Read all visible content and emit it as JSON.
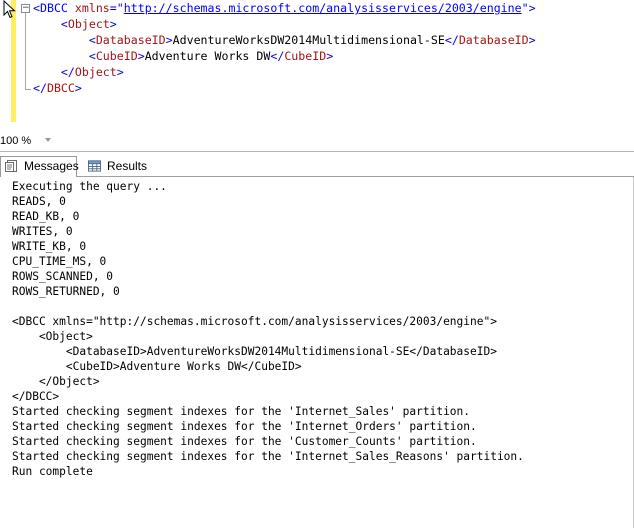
{
  "editor": {
    "lines": [
      {
        "indent": "",
        "parts": [
          {
            "text": "<DBCC ",
            "color": "blue"
          },
          {
            "text": "xmlns",
            "color": "red"
          },
          {
            "text": "=\"",
            "color": "blue"
          },
          {
            "text": "http://schemas.microsoft.com/analysisservices/2003/engine",
            "color": "link"
          },
          {
            "text": "\">",
            "color": "blue"
          }
        ]
      },
      {
        "indent": "    ",
        "parts": [
          {
            "text": "<",
            "color": "blue"
          },
          {
            "text": "Object",
            "color": "red"
          },
          {
            "text": ">",
            "color": "blue"
          }
        ]
      },
      {
        "indent": "        ",
        "parts": [
          {
            "text": "<",
            "color": "blue"
          },
          {
            "text": "DatabaseID",
            "color": "red"
          },
          {
            "text": ">",
            "color": "blue"
          },
          {
            "text": "AdventureWorksDW2014Multidimensional-SE",
            "color": "black"
          },
          {
            "text": "</",
            "color": "blue"
          },
          {
            "text": "DatabaseID",
            "color": "red"
          },
          {
            "text": ">",
            "color": "blue"
          }
        ]
      },
      {
        "indent": "        ",
        "parts": [
          {
            "text": "<",
            "color": "blue"
          },
          {
            "text": "CubeID",
            "color": "red"
          },
          {
            "text": ">",
            "color": "blue"
          },
          {
            "text": "Adventure Works DW",
            "color": "black"
          },
          {
            "text": "</",
            "color": "blue"
          },
          {
            "text": "CubeID",
            "color": "red"
          },
          {
            "text": ">",
            "color": "blue"
          }
        ]
      },
      {
        "indent": "    ",
        "parts": [
          {
            "text": "</",
            "color": "blue"
          },
          {
            "text": "Object",
            "color": "red"
          },
          {
            "text": ">",
            "color": "blue"
          }
        ]
      },
      {
        "indent": "",
        "parts": [
          {
            "text": "</",
            "color": "blue"
          },
          {
            "text": "DBCC",
            "color": "red"
          },
          {
            "text": ">",
            "color": "blue"
          }
        ]
      }
    ],
    "fold_glyph": "−"
  },
  "zoom": {
    "value": "100 %"
  },
  "tabs": {
    "messages_label": "Messages",
    "results_label": "Results"
  },
  "messages": [
    "Executing the query ...",
    "READS, 0",
    "READ_KB, 0",
    "WRITES, 0",
    "WRITE_KB, 0",
    "CPU_TIME_MS, 0",
    "ROWS_SCANNED, 0",
    "ROWS_RETURNED, 0",
    "",
    "<DBCC xmlns=\"http://schemas.microsoft.com/analysisservices/2003/engine\">",
    "    <Object>",
    "        <DatabaseID>AdventureWorksDW2014Multidimensional-SE</DatabaseID>",
    "        <CubeID>Adventure Works DW</CubeID>",
    "    </Object>",
    "</DBCC>",
    "Started checking segment indexes for the 'Internet_Sales' partition.",
    "Started checking segment indexes for the 'Internet_Orders' partition.",
    "Started checking segment indexes for the 'Customer_Counts' partition.",
    "Started checking segment indexes for the 'Internet_Sales_Reasons' partition.",
    "Run complete"
  ],
  "colors": {
    "blue": "#0000ff",
    "red": "#a31515",
    "black": "#000000",
    "link": "#0000ff",
    "change_bar": "#ffee62"
  }
}
